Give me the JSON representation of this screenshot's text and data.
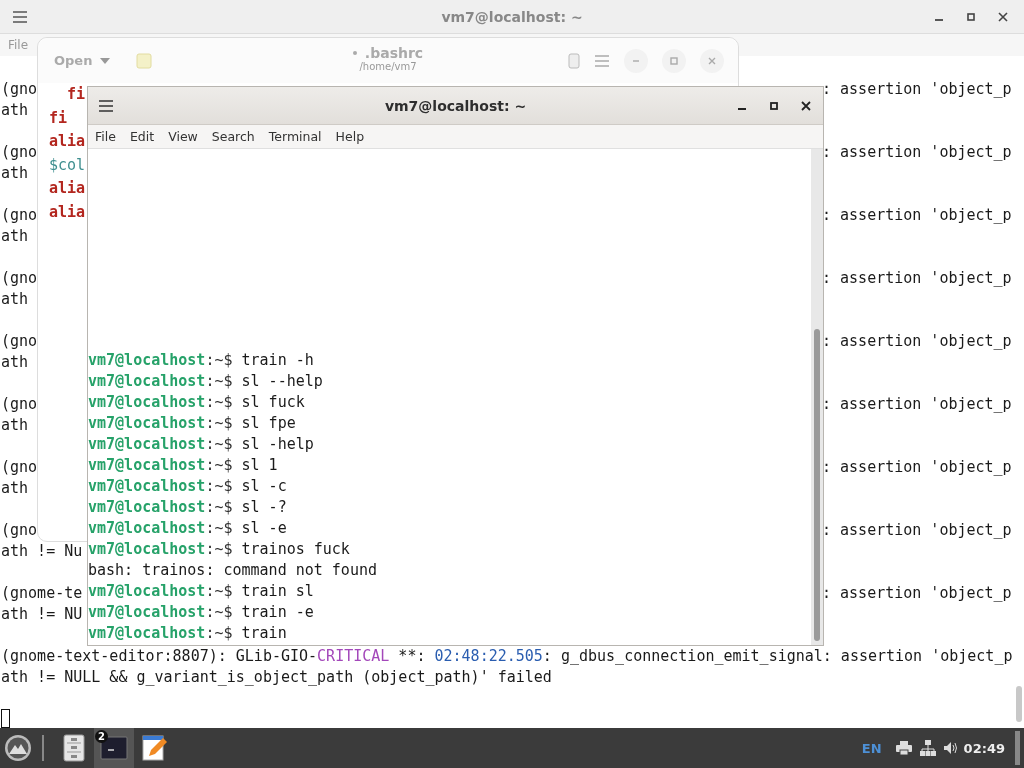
{
  "background_terminal": {
    "title": "vm7@localhost: ~",
    "menu": [
      "File"
    ],
    "messages": [
      {
        "left": "(gno",
        "right": ": assertion 'object_p",
        "second": "ath"
      },
      {
        "left": "(gno",
        "right": ": assertion 'object_p",
        "second": "ath"
      },
      {
        "left": "(gno",
        "right": ": assertion 'object_p",
        "second": "ath"
      },
      {
        "left": "(gno",
        "right": ": assertion 'object_p",
        "second": "ath"
      },
      {
        "left": "(gno",
        "right": ": assertion 'object_p",
        "second": "ath"
      },
      {
        "left": "(gno",
        "right": ": assertion 'object_p",
        "second": "ath"
      },
      {
        "left": "(gno",
        "right": ": assertion 'object_p",
        "second": "ath"
      },
      {
        "left": "(gno",
        "right": ": assertion 'object_p",
        "second": "ath != Nu"
      },
      {
        "left": "(gnome-te",
        "right": ": assertion 'object_p",
        "second": "ath != NU"
      },
      {
        "segments": [
          {
            "kind": "plain",
            "text": "(gnome-text-editor:8807): GLib-GIO-"
          },
          {
            "kind": "level",
            "text": "CRITICAL"
          },
          {
            "kind": "plain",
            "text": " **: "
          },
          {
            "kind": "time",
            "text": "02:48:22.505"
          },
          {
            "kind": "plain",
            "text": ": g_dbus_connection_emit_signal: assertion 'object_p"
          }
        ],
        "second": "ath != NULL && g_variant_is_object_path (object_path)' failed"
      }
    ]
  },
  "editor": {
    "open_button": "Open",
    "title": ".bashrc",
    "modified": true,
    "subtitle": "/home/vm7",
    "lines": [
      {
        "kind": "keyword",
        "text": "  fi"
      },
      {
        "kind": "keyword",
        "text": "fi"
      },
      {
        "kind": "keyword",
        "text": "alia"
      },
      {
        "kind": "variable",
        "text": "$col"
      },
      {
        "kind": "keyword",
        "text": "alia"
      },
      {
        "kind": "keyword",
        "text": "alia"
      }
    ]
  },
  "terminal": {
    "title": "vm7@localhost: ~",
    "menu": [
      "File",
      "Edit",
      "View",
      "Search",
      "Terminal",
      "Help"
    ],
    "lines": [
      {
        "kind": "prompt",
        "user": "vm7@localhost",
        "path": ":~$",
        "command": "train -h"
      },
      {
        "kind": "prompt",
        "user": "vm7@localhost",
        "path": ":~$",
        "command": "sl --help"
      },
      {
        "kind": "prompt",
        "user": "vm7@localhost",
        "path": ":~$",
        "command": "sl fuck"
      },
      {
        "kind": "prompt",
        "user": "vm7@localhost",
        "path": ":~$",
        "command": "sl fpe"
      },
      {
        "kind": "prompt",
        "user": "vm7@localhost",
        "path": ":~$",
        "command": "sl -help"
      },
      {
        "kind": "prompt",
        "user": "vm7@localhost",
        "path": ":~$",
        "command": "sl 1"
      },
      {
        "kind": "prompt",
        "user": "vm7@localhost",
        "path": ":~$",
        "command": "sl -c"
      },
      {
        "kind": "prompt",
        "user": "vm7@localhost",
        "path": ":~$",
        "command": "sl -?"
      },
      {
        "kind": "prompt",
        "user": "vm7@localhost",
        "path": ":~$",
        "command": "sl -e"
      },
      {
        "kind": "prompt",
        "user": "vm7@localhost",
        "path": ":~$",
        "command": "trainos fuck"
      },
      {
        "kind": "output",
        "text": "bash: trainos: command not found"
      },
      {
        "kind": "prompt",
        "user": "vm7@localhost",
        "path": ":~$",
        "command": "train sl"
      },
      {
        "kind": "prompt",
        "user": "vm7@localhost",
        "path": ":~$",
        "command": "train -e"
      },
      {
        "kind": "prompt",
        "user": "vm7@localhost",
        "path": ":~$",
        "command": "train"
      }
    ]
  },
  "taskbar": {
    "apps": [
      {
        "kind": "files",
        "selected": false
      },
      {
        "kind": "terminal",
        "selected": true,
        "badge": "2"
      },
      {
        "kind": "editor",
        "selected": false
      }
    ],
    "keyboard": "EN",
    "clock": "02:49"
  }
}
